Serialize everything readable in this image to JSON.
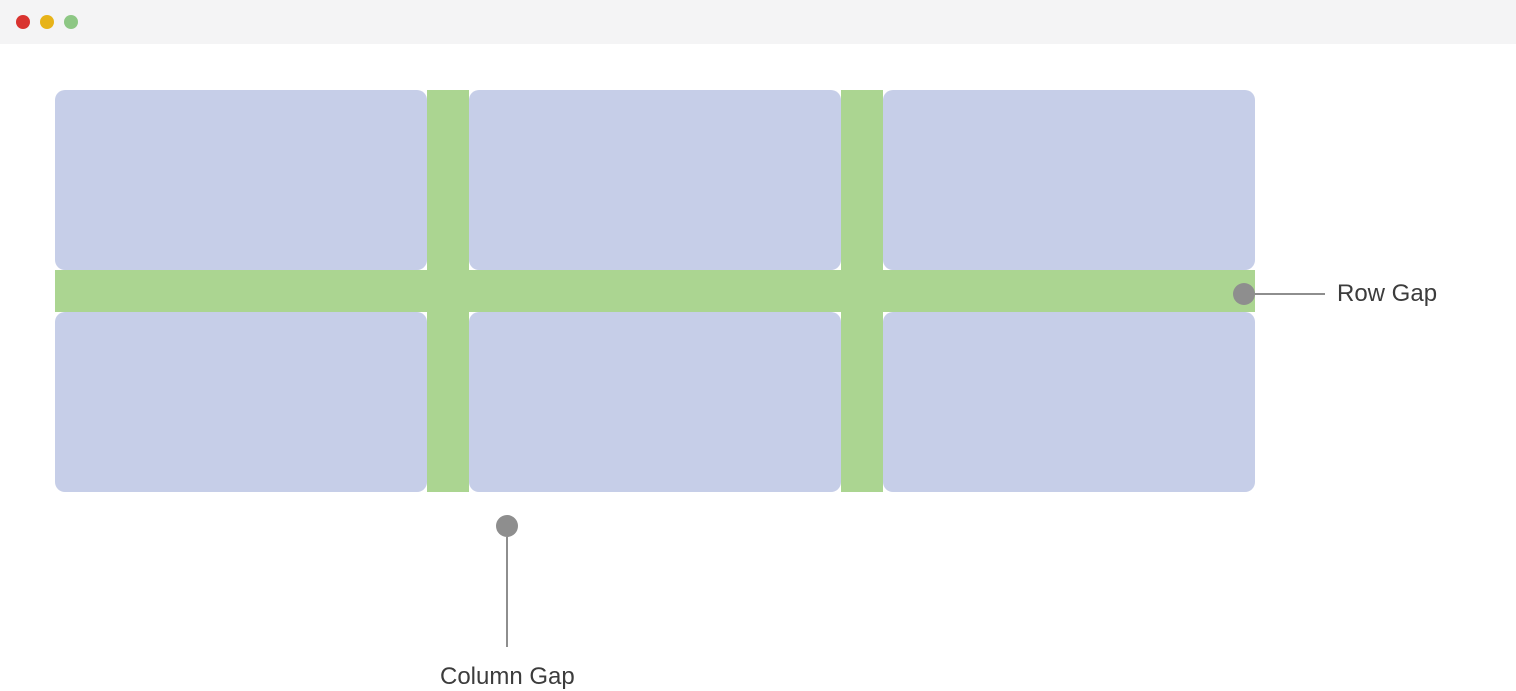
{
  "labels": {
    "row_gap": "Row Gap",
    "column_gap": "Column Gap"
  },
  "grid": {
    "columns": 3,
    "rows": 2,
    "cell_color": "#c6cee8",
    "gap_color": "#abd591"
  }
}
